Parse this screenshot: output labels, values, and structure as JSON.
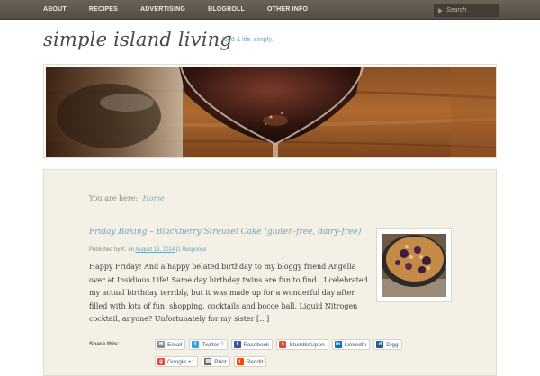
{
  "nav": {
    "items": [
      "ABOUT",
      "RECIPES",
      "ADVERTISING",
      "BLOGROLL",
      "OTHER INFO"
    ],
    "search_placeholder": "Search"
  },
  "site": {
    "title": "simple island living",
    "tagline": "food & life. simply."
  },
  "breadcrumb": {
    "prefix": "You are here:",
    "home": "Home"
  },
  "post": {
    "title": "Friday Baking – Blackberry Streusel Cake (gluten-free, dairy-free)",
    "meta_prefix": "Published by",
    "author": "K.",
    "meta_on": "on",
    "date": "August 13, 2014",
    "sep": "|",
    "responses": "1 Response",
    "excerpt": "Happy Friday!  And a happy belated birthday to my bloggy friend Angella over at Insidious Life!  Same day birthday twins are fun to find…I celebrated my actual birthday terribly, but it was made up for a wonderful day after filled with lots of fun, shopping, cocktails and bocce ball.  Liquid Nitrogen cocktail, anyone?  Unfortunately for my sister […]"
  },
  "share": {
    "label": "Share this:",
    "buttons": [
      {
        "label": "Email",
        "icon": "email-icon",
        "color": "#8a8a8a"
      },
      {
        "label": "Twitter",
        "count": "1",
        "icon": "twitter-icon",
        "color": "#3aa3d8"
      },
      {
        "label": "Facebook",
        "icon": "facebook-icon",
        "color": "#3b5998"
      },
      {
        "label": "StumbleUpon",
        "icon": "stumbleupon-icon",
        "color": "#eb4823"
      },
      {
        "label": "LinkedIn",
        "icon": "linkedin-icon",
        "color": "#0077b5"
      },
      {
        "label": "Digg",
        "icon": "digg-icon",
        "color": "#2a5a8a"
      },
      {
        "label": "Google +1",
        "icon": "google-plus-icon",
        "color": "#dd4b39"
      },
      {
        "label": "Print",
        "icon": "print-icon",
        "color": "#666666"
      },
      {
        "label": "Reddit",
        "icon": "reddit-icon",
        "color": "#ff4500"
      }
    ]
  }
}
